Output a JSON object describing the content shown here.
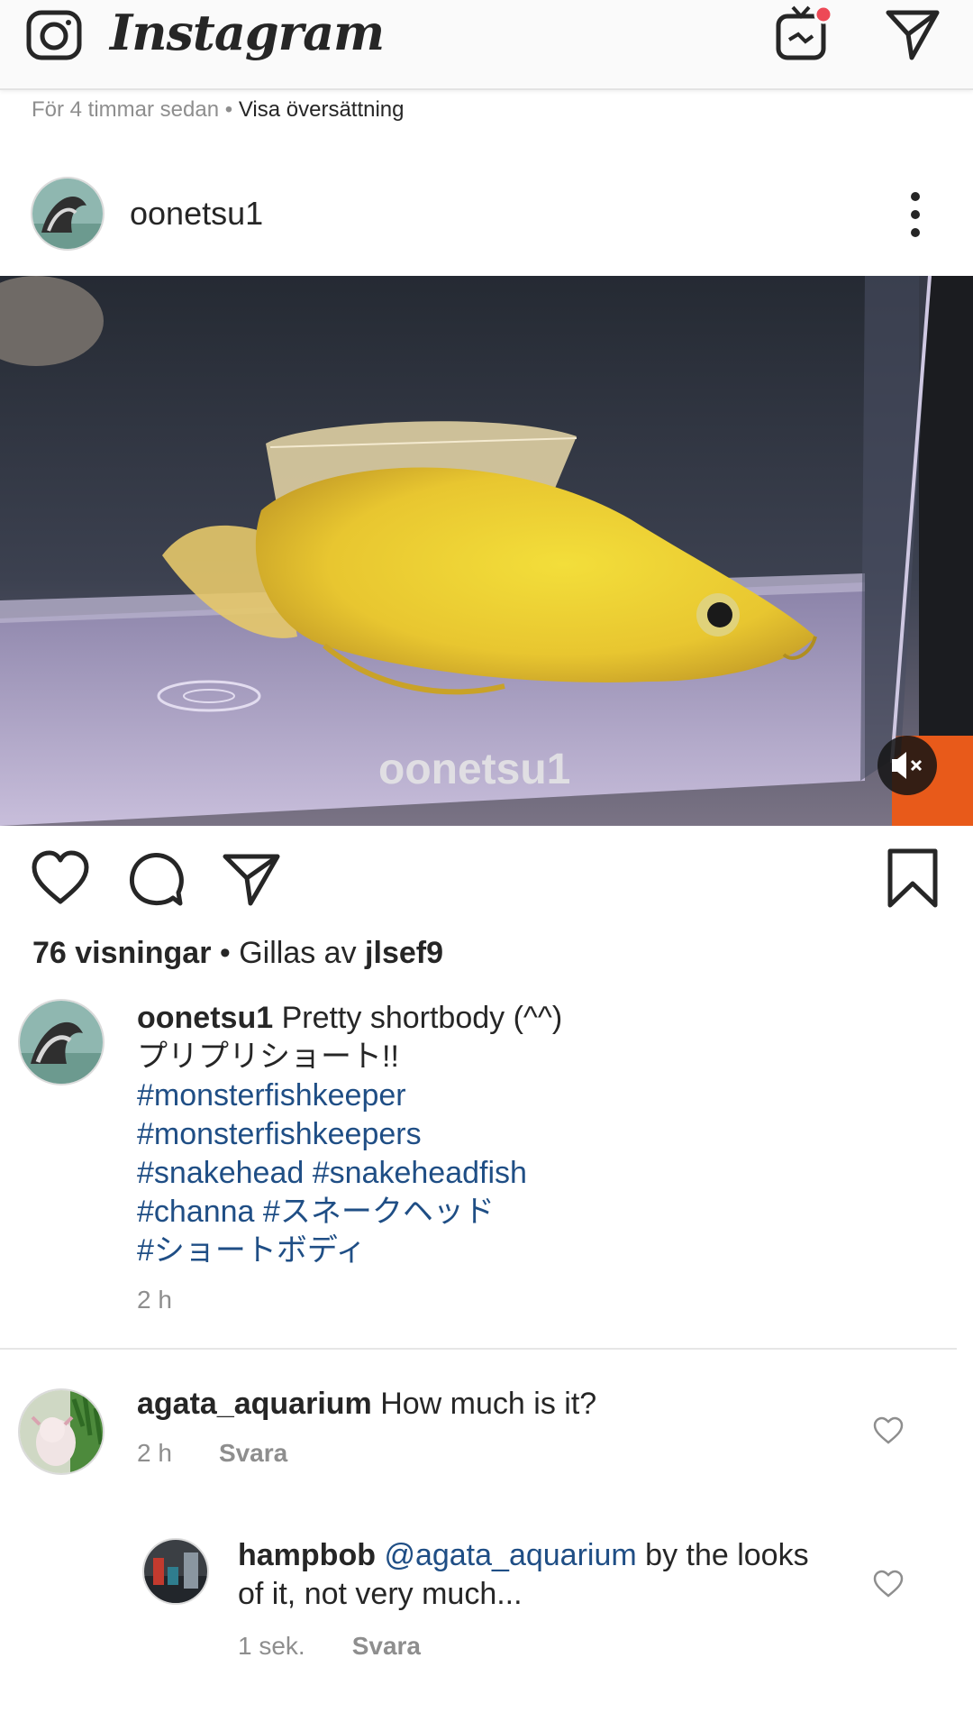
{
  "app": {
    "wordmark": "Instagram"
  },
  "feed": {
    "previous_post_time": "För 4 timmar sedan",
    "separator": " • ",
    "see_translation": "Visa översättning"
  },
  "post": {
    "username": "oonetsu1",
    "watermark": "oonetsu1",
    "views": "76 visningar",
    "liked_by_prefix": "Gillas av",
    "liked_by_user": "jlsef9",
    "caption": {
      "username": "oonetsu1",
      "text": "Pretty shortbody (^^)",
      "line2": "プリプリショート!!",
      "hashtags_line1": "#monsterfishkeeper",
      "hashtags_line2": "#monsterfishkeepers",
      "hashtags_line3a": "#snakehead",
      "hashtags_line3b": "#snakeheadfish",
      "hashtags_line4a": "#channa",
      "hashtags_line4b": "#スネークヘッド",
      "hashtags_line5": "#ショートボディ",
      "time": "2 h"
    }
  },
  "comments": [
    {
      "username": "agata_aquarium",
      "text": "How much is it?",
      "time": "2 h",
      "reply_label": "Svara"
    },
    {
      "username": "hampbob",
      "mention": "@agata_aquarium",
      "text_line1": "by the looks",
      "text_line2": "of it, not very much...",
      "time": "1 sek.",
      "reply_label": "Svara"
    }
  ],
  "icons": {
    "camera": "camera-icon",
    "igtv": "igtv-icon",
    "direct": "direct-message-icon",
    "more": "more-options-icon",
    "like": "heart-icon",
    "comment": "comment-icon",
    "share": "share-icon",
    "save": "bookmark-icon",
    "mute": "muted-speaker-icon"
  },
  "colors": {
    "notification_dot": "#ed4956",
    "hashtag": "#1f4e85",
    "secondary_text": "#8e8e8e"
  }
}
